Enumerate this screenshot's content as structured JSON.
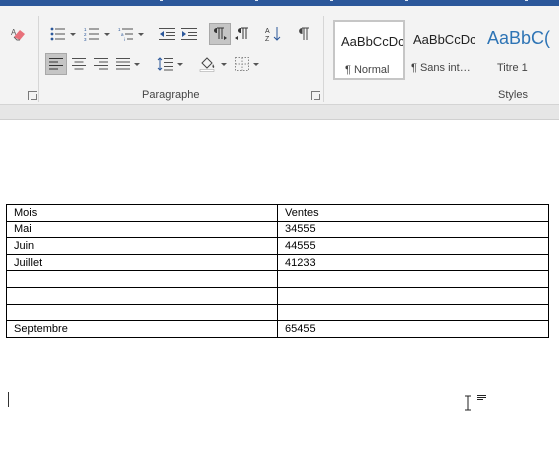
{
  "ribbon": {
    "groups": {
      "paragraph_label": "Paragraphe",
      "styles_label": "Styles"
    },
    "paragraph_buttons": [
      {
        "name": "bullets",
        "icon": "bullet-list-icon"
      },
      {
        "name": "numbering",
        "icon": "numbered-list-icon"
      },
      {
        "name": "multilevel",
        "icon": "multilevel-list-icon"
      },
      {
        "name": "decrease-indent",
        "icon": "decrease-indent-icon"
      },
      {
        "name": "increase-indent",
        "icon": "increase-indent-icon"
      },
      {
        "name": "ltr",
        "icon": "left-to-right-icon",
        "active": true
      },
      {
        "name": "rtl",
        "icon": "right-to-left-icon"
      },
      {
        "name": "sort",
        "icon": "sort-az-icon"
      },
      {
        "name": "show-marks",
        "icon": "pilcrow-icon"
      }
    ],
    "styles": [
      {
        "preview": "AaBbCcDc",
        "name": "¶ Normal",
        "selected": true
      },
      {
        "preview": "AaBbCcDc",
        "name": "¶ Sans int…",
        "selected": false
      },
      {
        "preview": "AaBbC(",
        "name": "Titre 1",
        "selected": false
      }
    ],
    "colors": {
      "accent": "#2b579a",
      "heading_style": "#2e74b5",
      "ribbon_bg": "#f3f3f3"
    }
  },
  "document": {
    "table": {
      "rows": [
        [
          "Mois",
          "Ventes"
        ],
        [
          "Mai",
          "34555"
        ],
        [
          "Juin",
          "44555"
        ],
        [
          "Juillet",
          "41233"
        ],
        [
          "",
          ""
        ],
        [
          "",
          ""
        ],
        [
          "",
          ""
        ],
        [
          "Septembre",
          "65455"
        ]
      ]
    }
  }
}
